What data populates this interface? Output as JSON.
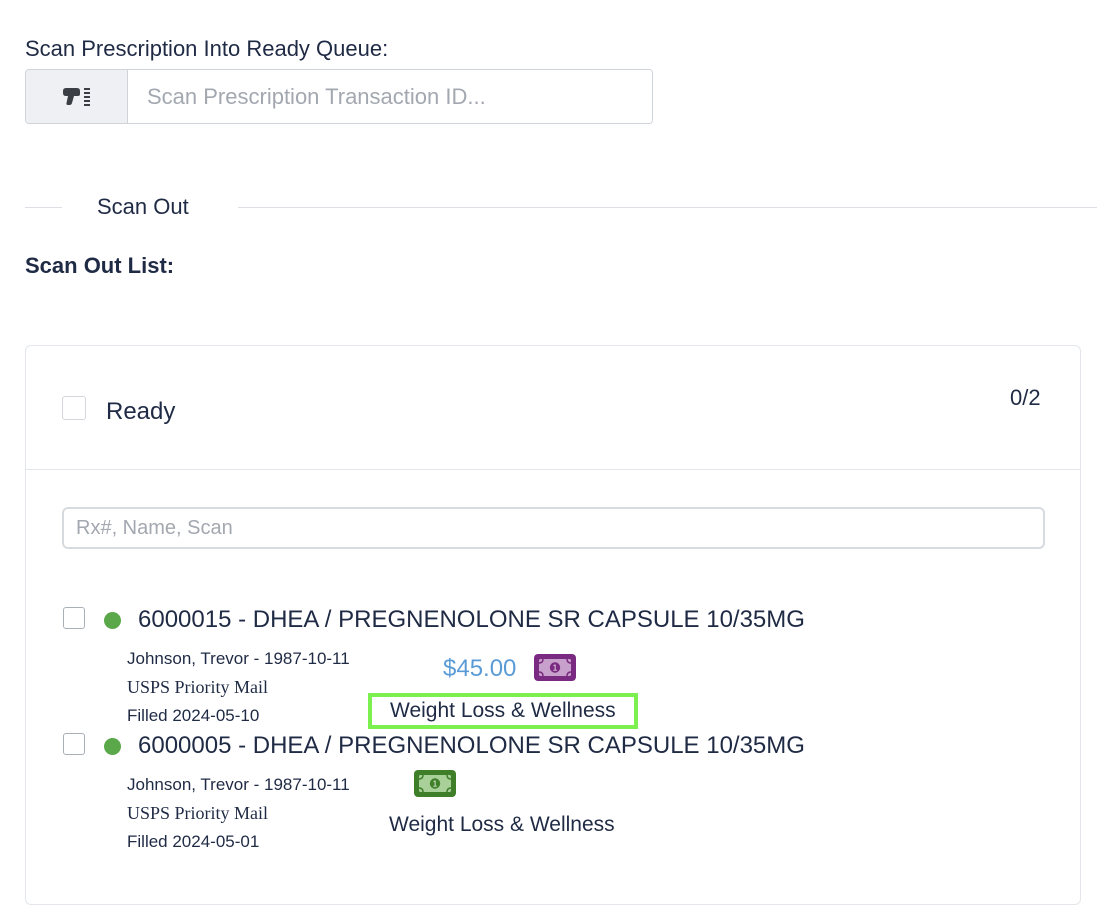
{
  "scan": {
    "label": "Scan Prescription Into Ready Queue:",
    "placeholder": "Scan Prescription Transaction ID...",
    "value": ""
  },
  "section": {
    "divider_label": "Scan Out",
    "list_heading": "Scan Out List:"
  },
  "card": {
    "select_all_label": "Ready",
    "count": "0/2",
    "filter_placeholder": "Rx#, Name, Scan",
    "filter_value": ""
  },
  "prescriptions": [
    {
      "title": "6000015 - DHEA / PREGNENOLONE SR CAPSULE 10/35MG",
      "patient": "Johnson, Trevor - 1987-10-11",
      "shipping": "USPS Priority Mail",
      "filled": "Filled 2024-05-10",
      "price": "$45.00",
      "payment_icon": "money-bill-icon",
      "payment_color": "#7a2a80",
      "clinic": "Weight Loss & Wellness",
      "status_color": "#5aa84a"
    },
    {
      "title": "6000005 - DHEA / PREGNENOLONE SR CAPSULE 10/35MG",
      "patient": "Johnson, Trevor - 1987-10-11",
      "shipping": "USPS Priority Mail",
      "filled": "Filled 2024-05-01",
      "price": "",
      "payment_icon": "money-bill-icon",
      "payment_color": "#3f7f2a",
      "clinic": "Weight Loss & Wellness",
      "status_color": "#5aa84a"
    }
  ],
  "colors": {
    "highlight_border": "#7cf04f",
    "price": "#5b9bd5",
    "text": "#1f2a44"
  }
}
